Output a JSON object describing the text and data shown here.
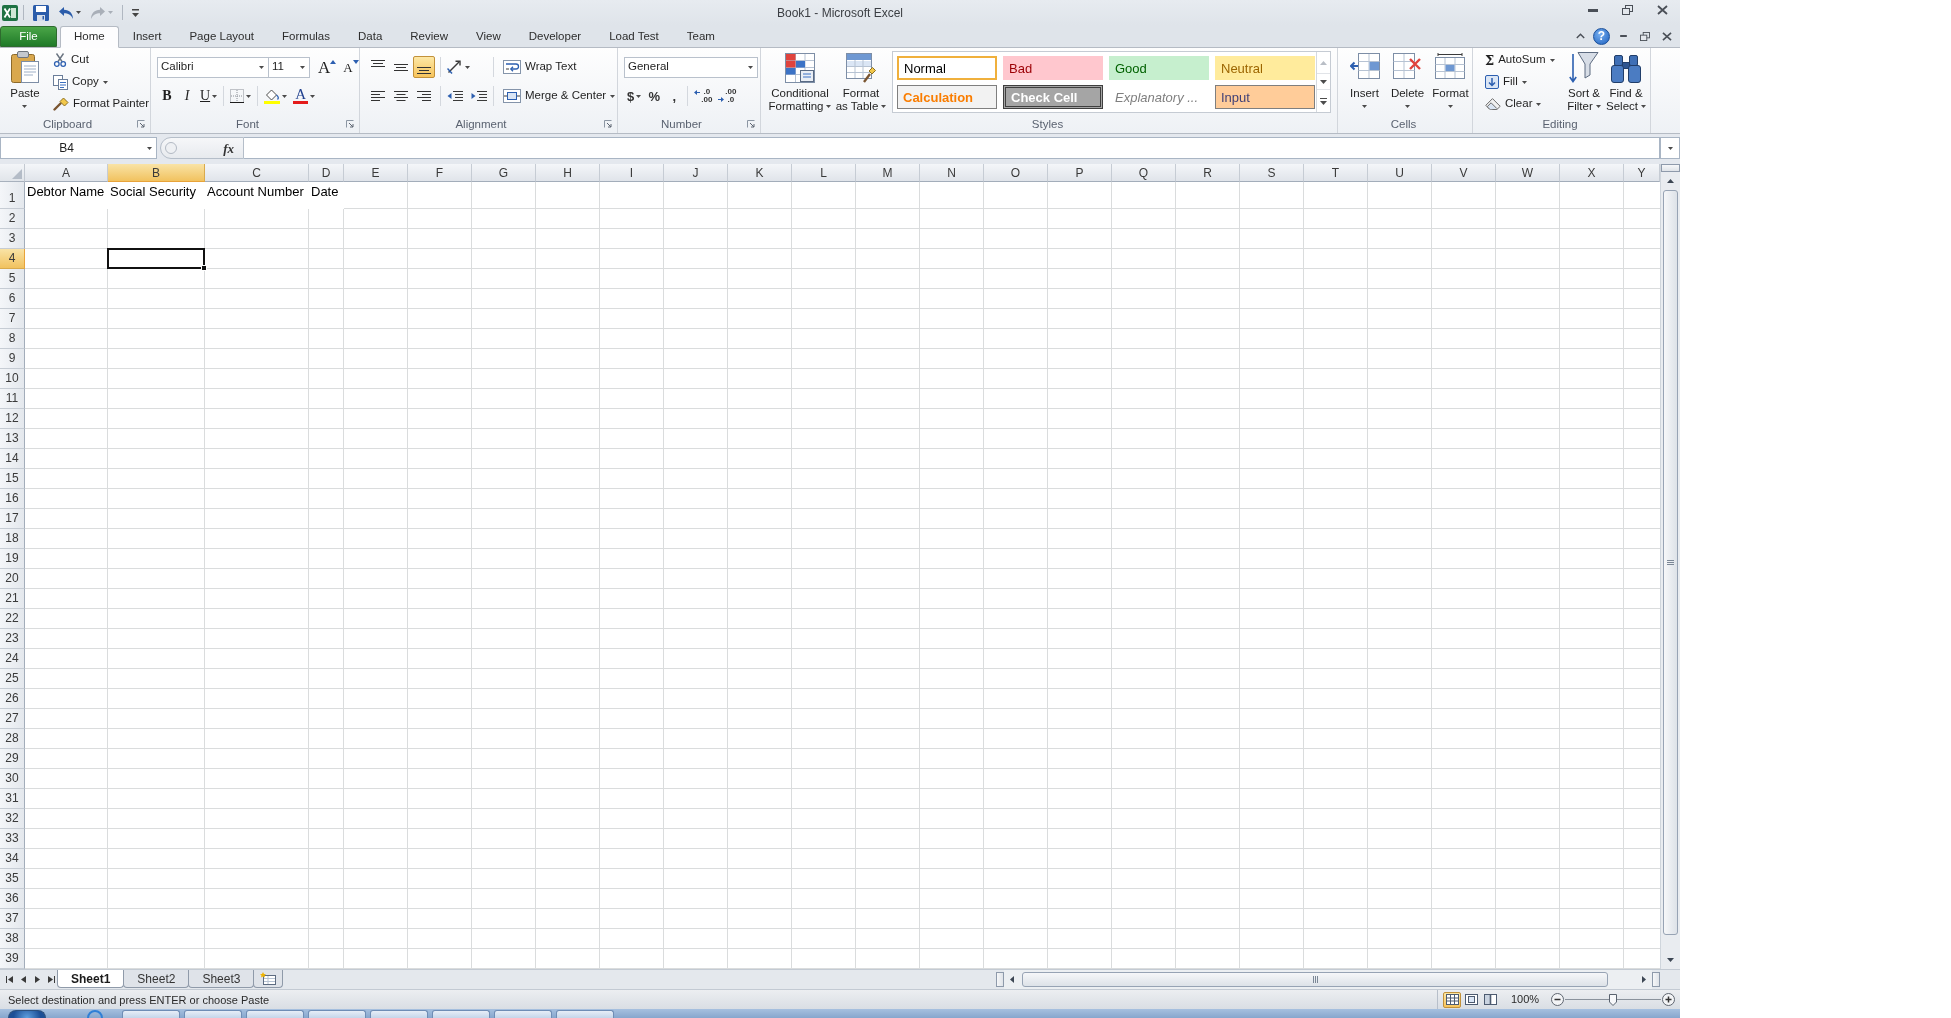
{
  "window": {
    "title": "Book1 - Microsoft Excel"
  },
  "quick_access": [
    {
      "kind": "save",
      "disabled": false
    },
    {
      "kind": "undo",
      "disabled": false
    },
    {
      "kind": "redo",
      "disabled": true
    }
  ],
  "ribbon_tabs": [
    {
      "label": "File",
      "kind": "backstage",
      "selected": false
    },
    {
      "label": "Home",
      "kind": "tab",
      "selected": true
    },
    {
      "label": "Insert",
      "kind": "tab",
      "selected": false
    },
    {
      "label": "Page Layout",
      "kind": "tab",
      "selected": false
    },
    {
      "label": "Formulas",
      "kind": "tab",
      "selected": false
    },
    {
      "label": "Data",
      "kind": "tab",
      "selected": false
    },
    {
      "label": "Review",
      "kind": "tab",
      "selected": false
    },
    {
      "label": "View",
      "kind": "tab",
      "selected": false
    },
    {
      "label": "Developer",
      "kind": "tab",
      "selected": false
    },
    {
      "label": "Load Test",
      "kind": "tab",
      "selected": false
    },
    {
      "label": "Team",
      "kind": "tab",
      "selected": false
    }
  ],
  "help": "?",
  "clipboard": {
    "label": "Clipboard",
    "paste": "Paste",
    "cut": "Cut",
    "copy": "Copy",
    "format_painter": "Format Painter"
  },
  "font": {
    "label": "Font",
    "font_name": "Calibri",
    "font_size": "11",
    "grow_font": "A",
    "shrink_font": "A",
    "bold": "B",
    "italic": "I",
    "underline": "U",
    "font_color": "A"
  },
  "alignment": {
    "label": "Alignment",
    "vertical": [
      {
        "kind": "top",
        "selected": false
      },
      {
        "kind": "middle",
        "selected": false
      },
      {
        "kind": "bottom",
        "selected": true
      }
    ],
    "horizontal": [
      {
        "kind": "left",
        "selected": false
      },
      {
        "kind": "center",
        "selected": false
      },
      {
        "kind": "right",
        "selected": false
      }
    ],
    "wrap_text": "Wrap Text",
    "merge_center": "Merge & Center"
  },
  "number": {
    "label": "Number",
    "format": "General",
    "currency": "$",
    "percent": "%",
    "comma": ",",
    "increase_decimal": [
      ".0",
      ".00"
    ],
    "decrease_decimal": [
      ".00",
      ".0"
    ]
  },
  "styles": {
    "label": "Styles",
    "conditional_formatting": [
      "Conditional",
      "Formatting"
    ],
    "format_as_table": [
      "Format",
      "as Table"
    ],
    "gallery": [
      {
        "label": "Normal",
        "kind": "normal",
        "selected": true
      },
      {
        "label": "Bad",
        "kind": "bad",
        "selected": false
      },
      {
        "label": "Good",
        "kind": "good",
        "selected": false
      },
      {
        "label": "Neutral",
        "kind": "neutral",
        "selected": false
      },
      {
        "label": "Calculation",
        "kind": "calculation",
        "selected": false
      },
      {
        "label": "Check Cell",
        "kind": "check",
        "selected": false
      },
      {
        "label": "Explanatory ...",
        "kind": "explanatory",
        "selected": false
      },
      {
        "label": "Input",
        "kind": "input",
        "selected": false
      }
    ],
    "gallery_up_disabled": true
  },
  "cells": {
    "label": "Cells",
    "buttons": [
      {
        "label": "Insert",
        "kind": "insert"
      },
      {
        "label": "Delete",
        "kind": "delete"
      },
      {
        "label": "Format",
        "kind": "format"
      }
    ]
  },
  "editing": {
    "label": "Editing",
    "autosum_symbol": "Σ",
    "autosum": "AutoSum",
    "fill": "Fill",
    "clear": "Clear",
    "sort_filter": [
      "Sort &",
      "Filter"
    ],
    "find_select": [
      "Find &",
      "Select"
    ]
  },
  "formula_bar": {
    "name_box": "B4",
    "function_label": "fx"
  },
  "sheet": {
    "columns": [
      {
        "label": "A",
        "selected": false
      },
      {
        "label": "B",
        "selected": true
      },
      {
        "label": "C",
        "selected": false
      },
      {
        "label": "D",
        "selected": false
      },
      {
        "label": "E",
        "selected": false
      },
      {
        "label": "F",
        "selected": false
      },
      {
        "label": "G",
        "selected": false
      },
      {
        "label": "H",
        "selected": false
      },
      {
        "label": "I",
        "selected": false
      },
      {
        "label": "J",
        "selected": false
      },
      {
        "label": "K",
        "selected": false
      },
      {
        "label": "L",
        "selected": false
      },
      {
        "label": "M",
        "selected": false
      },
      {
        "label": "N",
        "selected": false
      },
      {
        "label": "O",
        "selected": false
      },
      {
        "label": "P",
        "selected": false
      },
      {
        "label": "Q",
        "selected": false
      },
      {
        "label": "R",
        "selected": false
      },
      {
        "label": "S",
        "selected": false
      },
      {
        "label": "T",
        "selected": false
      },
      {
        "label": "U",
        "selected": false
      },
      {
        "label": "V",
        "selected": false
      },
      {
        "label": "W",
        "selected": false
      },
      {
        "label": "X",
        "selected": false
      },
      {
        "label": "Y",
        "selected": false
      }
    ],
    "rows": [
      {
        "label": "1",
        "selected": false,
        "cells": [
          "Debtor Name",
          "Social Security",
          "Account Number",
          "Date"
        ]
      },
      {
        "label": "2",
        "selected": false
      },
      {
        "label": "3",
        "selected": false
      },
      {
        "label": "4",
        "selected": true
      },
      {
        "label": "5",
        "selected": false
      },
      {
        "label": "6",
        "selected": false
      },
      {
        "label": "7",
        "selected": false
      },
      {
        "label": "8",
        "selected": false
      },
      {
        "label": "9",
        "selected": false
      },
      {
        "label": "10",
        "selected": false
      },
      {
        "label": "11",
        "selected": false
      },
      {
        "label": "12",
        "selected": false
      },
      {
        "label": "13",
        "selected": false
      },
      {
        "label": "14",
        "selected": false
      },
      {
        "label": "15",
        "selected": false
      },
      {
        "label": "16",
        "selected": false
      },
      {
        "label": "17",
        "selected": false
      },
      {
        "label": "18",
        "selected": false
      },
      {
        "label": "19",
        "selected": false
      },
      {
        "label": "20",
        "selected": false
      },
      {
        "label": "21",
        "selected": false
      },
      {
        "label": "22",
        "selected": false
      },
      {
        "label": "23",
        "selected": false
      },
      {
        "label": "24",
        "selected": false
      },
      {
        "label": "25",
        "selected": false
      },
      {
        "label": "26",
        "selected": false
      },
      {
        "label": "27",
        "selected": false
      },
      {
        "label": "28",
        "selected": false
      },
      {
        "label": "29",
        "selected": false
      },
      {
        "label": "30",
        "selected": false
      },
      {
        "label": "31",
        "selected": false
      },
      {
        "label": "32",
        "selected": false
      },
      {
        "label": "33",
        "selected": false
      },
      {
        "label": "34",
        "selected": false
      },
      {
        "label": "35",
        "selected": false
      },
      {
        "label": "36",
        "selected": false
      },
      {
        "label": "37",
        "selected": false
      },
      {
        "label": "38",
        "selected": false
      },
      {
        "label": "39",
        "selected": false
      }
    ]
  },
  "sheet_tabs": [
    {
      "label": "Sheet1",
      "selected": true
    },
    {
      "label": "Sheet2",
      "selected": false
    },
    {
      "label": "Sheet3",
      "selected": false
    }
  ],
  "status_bar": {
    "message": "Select destination and press ENTER or choose Paste",
    "views": [
      {
        "kind": "normal",
        "selected": true
      },
      {
        "kind": "page_layout",
        "selected": false
      },
      {
        "kind": "page_break",
        "selected": false
      }
    ],
    "zoom": "100%",
    "zoom_slider": {
      "level": 0.5
    }
  }
}
